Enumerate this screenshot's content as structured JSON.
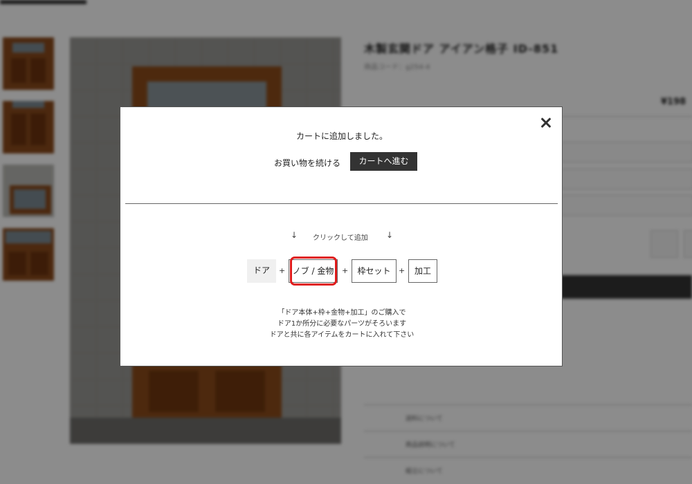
{
  "background": {
    "product_title": "木製玄関ドア アイアン格子 ID-851",
    "product_code": "商品コード：g254-4",
    "price": "¥198",
    "rows": [
      "送料について",
      "商品説明について",
      "組立について"
    ]
  },
  "modal": {
    "added_message": "カートに追加しました。",
    "continue_label": "お買い物を続ける",
    "proceed_label": "カートへ進む",
    "hint": "クリックして追加",
    "arrow_left": "↓",
    "arrow_right": "↓",
    "parts": [
      {
        "label": "ドア"
      },
      {
        "label": "ノブ / 金物"
      },
      {
        "label": "枠セット"
      },
      {
        "label": "加工"
      }
    ],
    "plus": "+",
    "note_lines": [
      "「ドア本体+枠+金物+加工」のご購入で",
      "ドア1か所分に必要なパーツがそろいます",
      "ドアと共に各アイテムをカートに入れて下さい"
    ]
  },
  "colors": {
    "highlight": "#e01b1b",
    "dark_button": "#333333"
  }
}
